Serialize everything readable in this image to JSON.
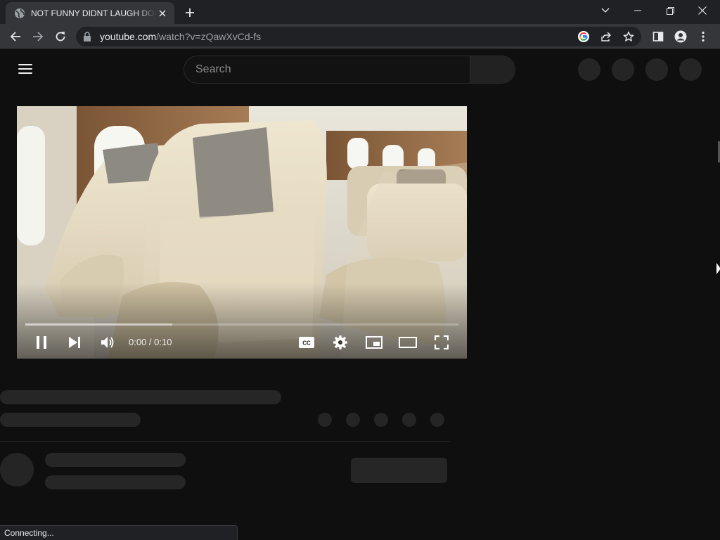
{
  "tab": {
    "title": "NOT FUNNY DIDNT LAUGH DON",
    "favicon": "globe-icon",
    "close_icon": "close-icon"
  },
  "new_tab_icon": "plus-icon",
  "window_controls": [
    "chevron-down-icon",
    "minimize-icon",
    "restore-icon",
    "close-icon"
  ],
  "nav": {
    "back": "arrow-left-icon",
    "forward": "arrow-right-icon",
    "reload": "reload-icon"
  },
  "omnibox": {
    "lock_icon": "lock-icon",
    "host": "youtube.com",
    "path": "/watch?v=zQawXvCd-fs",
    "icons": [
      "google-icon",
      "share-icon",
      "star-icon"
    ]
  },
  "toolbar_icons": [
    "side-panel-icon",
    "profile-icon",
    "kebab-menu-icon"
  ],
  "youtube": {
    "menu_icon": "hamburger-icon",
    "search": {
      "placeholder": "Search",
      "value": ""
    }
  },
  "player": {
    "controls": [
      "pause-icon",
      "next-icon",
      "volume-icon",
      "captions-icon",
      "settings-icon",
      "miniplayer-icon",
      "theater-icon",
      "fullscreen-icon"
    ],
    "time": "0:00 / 0:10",
    "played_fraction": 0.0,
    "buffered_fraction": 0.34
  },
  "status_text": "Connecting...",
  "colors": {
    "chrome_dark": "#202124",
    "chrome_mid": "#35363a",
    "page_bg": "#0f0f0f",
    "skeleton": "#262626",
    "progress": "#ff0000"
  }
}
